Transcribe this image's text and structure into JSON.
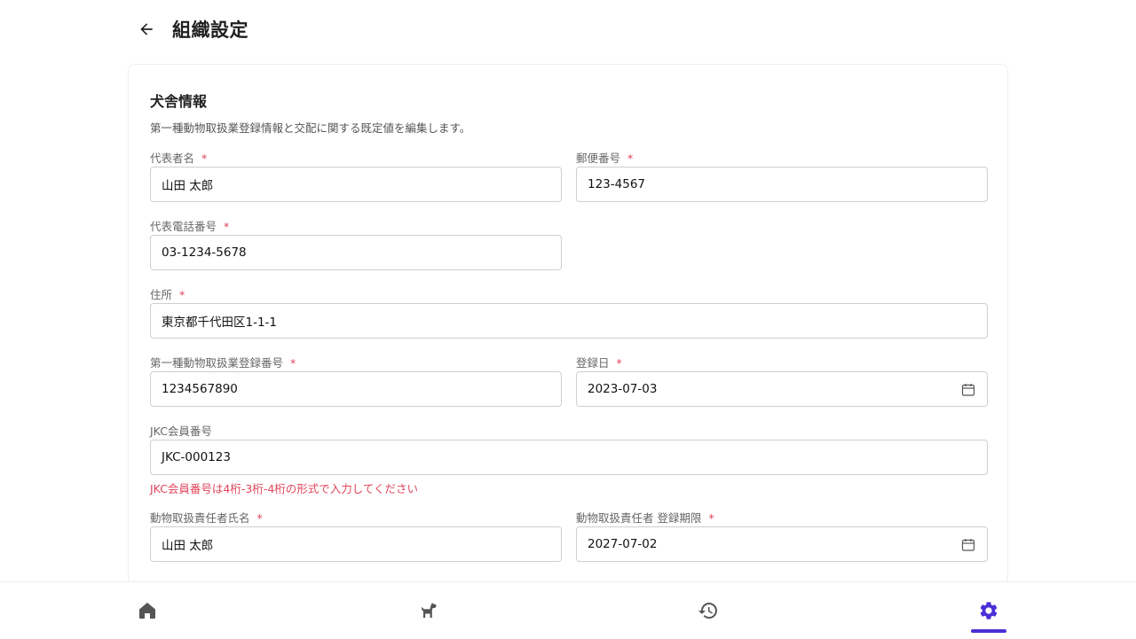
{
  "header": {
    "title": "組織設定"
  },
  "section": {
    "title": "犬舎情報",
    "description": "第一種動物取扱業登録情報と交配に関する既定値を編集します。"
  },
  "fields": {
    "representative_name": {
      "label": "代表者名",
      "value": "山田 太郎"
    },
    "postal_code": {
      "label": "郵便番号",
      "value": "123-4567"
    },
    "phone": {
      "label": "代表電話番号",
      "value": "03-1234-5678"
    },
    "address": {
      "label": "住所",
      "value": "東京都千代田区1-1-1"
    },
    "registration_number": {
      "label": "第一種動物取扱業登録番号",
      "value": "1234567890"
    },
    "registration_date": {
      "label": "登録日",
      "value": "2023-07-03"
    },
    "jkc_number": {
      "label": "JKC会員番号",
      "value": "JKC-000123",
      "error": "JKC会員番号は4桁-3桁-4桁の形式で入力してください"
    },
    "manager_name": {
      "label": "動物取扱責任者氏名",
      "value": "山田 太郎"
    },
    "manager_expiry": {
      "label": "動物取扱責任者 登録期限",
      "value": "2027-07-02"
    }
  },
  "required_mark": "*",
  "colors": {
    "accent": "#4b2fd6",
    "error": "#e0445a",
    "icon": "#555555"
  },
  "nav": {
    "items": [
      {
        "icon": "home-icon"
      },
      {
        "icon": "dog-icon"
      },
      {
        "icon": "history-icon"
      },
      {
        "icon": "gear-icon",
        "active": true
      }
    ]
  }
}
